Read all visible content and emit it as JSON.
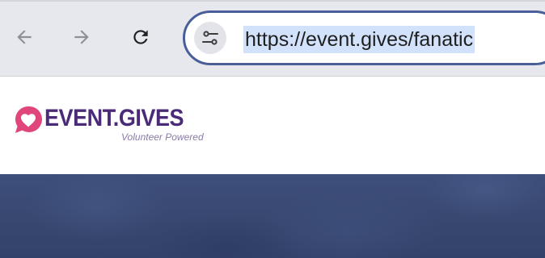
{
  "browser": {
    "url": "https://event.gives/fanatic",
    "icons": {
      "back": "arrow-left-icon",
      "forward": "arrow-right-icon",
      "reload": "reload-icon",
      "site_settings": "tune-icon"
    }
  },
  "site": {
    "logo_text": "EVENT.GIVES",
    "tagline": "Volunteer Powered",
    "logo_icon": "heart-speech-bubble-icon",
    "colors": {
      "brand_purple": "#4b2a78",
      "brand_pink": "#e0457b",
      "tagline": "#8a7aa6",
      "hero": "#3e4f7c"
    }
  }
}
